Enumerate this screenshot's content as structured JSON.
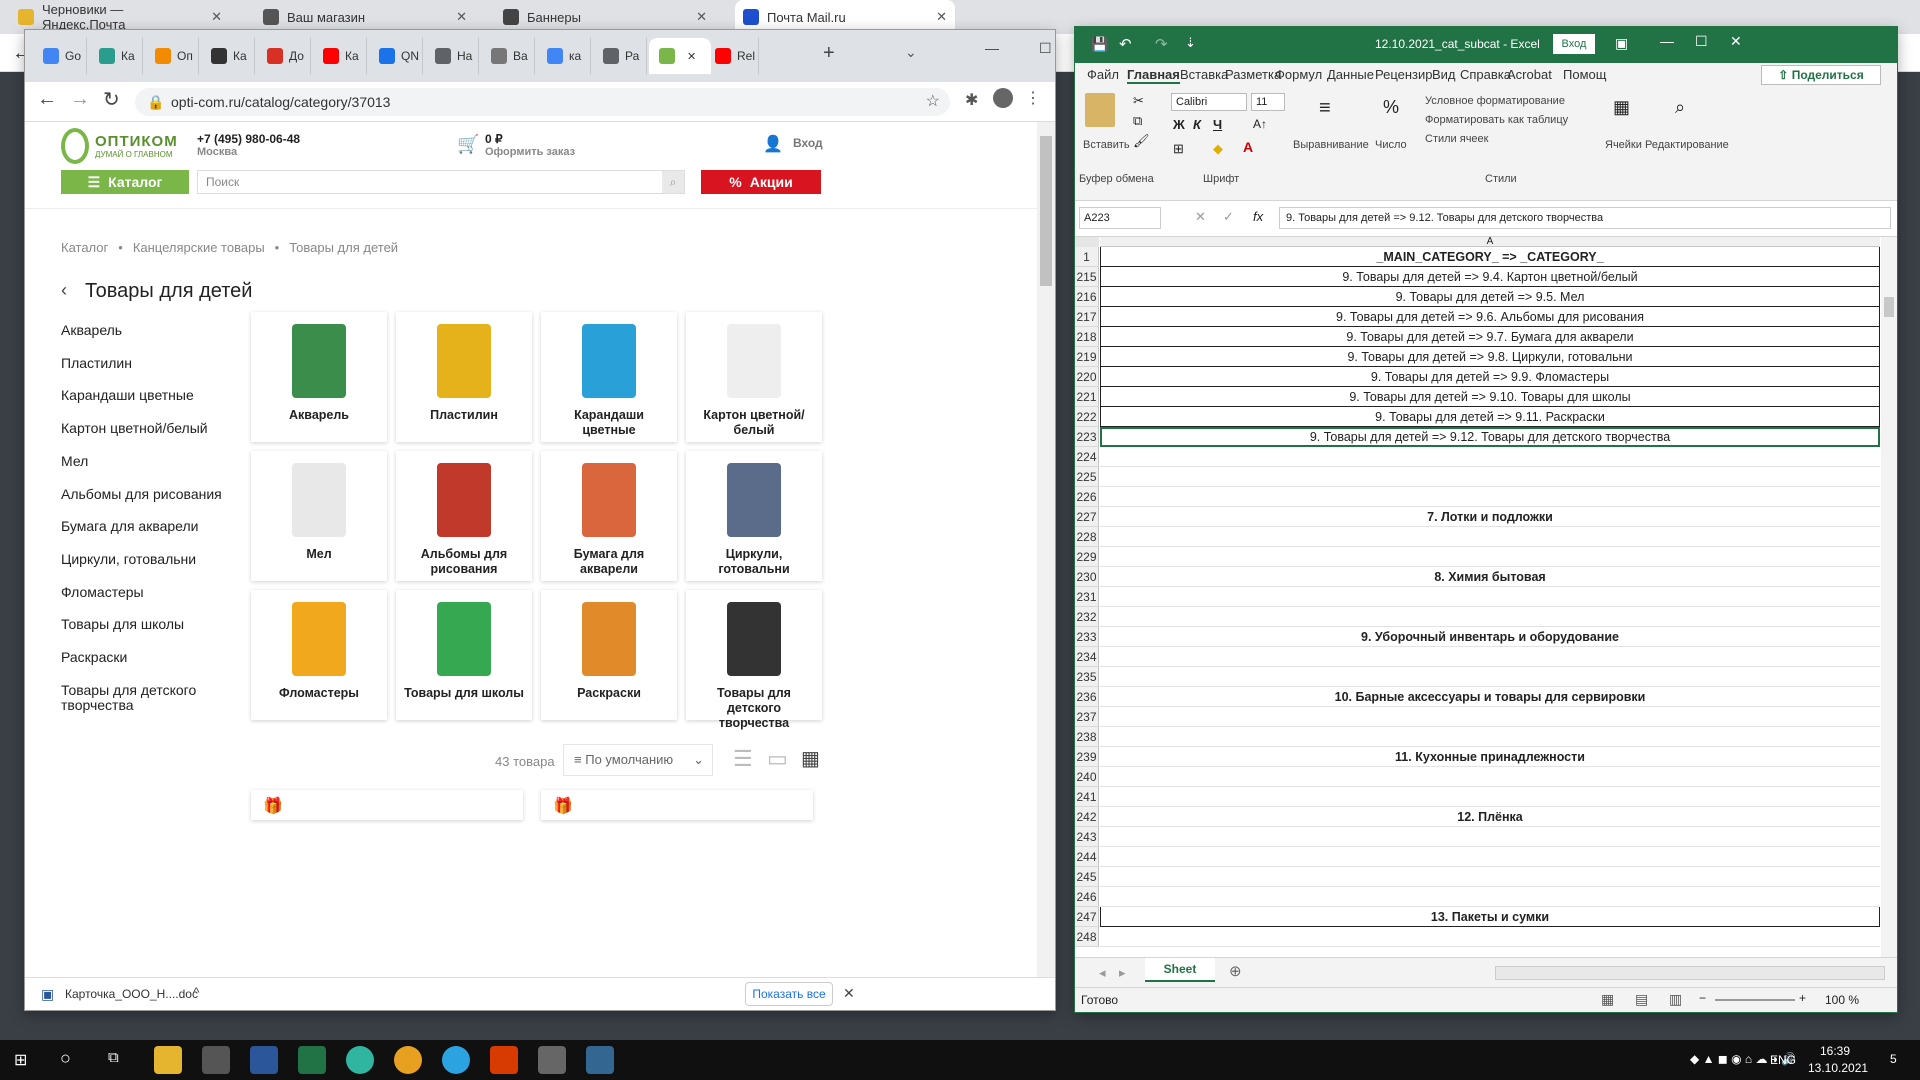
{
  "outer_tabs": [
    {
      "title": "Черновики — Яндекс.Почта",
      "color": "#e6b52f"
    },
    {
      "title": "Ваш магазин",
      "color": "#555555"
    },
    {
      "title": "Баннеры",
      "color": "#444444"
    },
    {
      "title": "Почта Mail.ru",
      "color": "#1d4fcf"
    }
  ],
  "chrome": {
    "tabs": [
      "Go",
      "Ка",
      "Оп",
      "Ка",
      "До",
      "Ка",
      "QN",
      "На",
      "Ва",
      "ка",
      "Ра",
      "",
      "Rel"
    ],
    "tab_colors": [
      "#4285f4",
      "#2a9d8f",
      "#f28b00",
      "#333333",
      "#d93025",
      "#ff0000",
      "#1a73e8",
      "#5f6368",
      "#777777",
      "#4285f4",
      "#5f6368",
      "#7ab648",
      "#ff0000"
    ],
    "url": "opti-com.ru/catalog/category/37013"
  },
  "site": {
    "logo_text": "ОПТИКОМ",
    "logo_tagline": "ДУМАЙ О ГЛАВНОМ",
    "phone": "+7 (495) 980-06-48",
    "city": "Москва",
    "cart_sum": "0 ₽",
    "cart_action": "Оформить заказ",
    "login": "Вход",
    "catalog_btn": "Каталог",
    "search_placeholder": "Поиск",
    "promo_btn": "Акции",
    "breadcrumb": [
      "Каталог",
      "Канцелярские товары",
      "Товары для детей"
    ],
    "page_title": "Товары для детей",
    "sidebar": [
      "Акварель",
      "Пластилин",
      "Карандаши цветные",
      "Картон цветной/белый",
      "Мел",
      "Альбомы для рисования",
      "Бумага для акварели",
      "Циркули, готовальни",
      "Фломастеры",
      "Товары для школы",
      "Раскраски",
      "Товары для детского творчества"
    ],
    "cards": [
      {
        "label": "Акварель",
        "color": "#3a8d4a"
      },
      {
        "label": "Пластилин",
        "color": "#e5b21b"
      },
      {
        "label": "Карандаши цветные",
        "color": "#2aa0d8"
      },
      {
        "label": "Картон цветной/ белый",
        "color": "#eeeeee"
      },
      {
        "label": "Мел",
        "color": "#e8e8e8"
      },
      {
        "label": "Альбомы для рисования",
        "color": "#c0392b"
      },
      {
        "label": "Бумага для акварели",
        "color": "#d9663c"
      },
      {
        "label": "Циркули, готовальни",
        "color": "#5b6c8a"
      },
      {
        "label": "Фломастеры",
        "color": "#f2a81d"
      },
      {
        "label": "Товары для школы",
        "color": "#36a852"
      },
      {
        "label": "Раскраски",
        "color": "#e08a2a"
      },
      {
        "label": "Товары для детского творчества",
        "color": "#333333"
      }
    ],
    "count": "43 товара",
    "sort": "По умолчанию"
  },
  "download": {
    "file": "Карточка_ООО_Н....doc",
    "show_all": "Показать все"
  },
  "excel": {
    "title": "12.10.2021_cat_subcat - Excel",
    "login": "Вход",
    "menu": [
      "Файл",
      "Главная",
      "Вставка",
      "Разметка",
      "Формул",
      "Данные",
      "Рецензир",
      "Вид",
      "Справка",
      "Acrobat",
      "Помощ"
    ],
    "share": "Поделиться",
    "ribbon": {
      "paste": "Вставить",
      "clipboard": "Буфер обмена",
      "font_name": "Calibri",
      "font_size": "11",
      "font_group": "Шрифт",
      "align": "Выравнивание",
      "number": "Число",
      "cond": "Условное форматирование",
      "as_table": "Форматировать как таблицу",
      "cell_styles": "Стили ячеек",
      "styles": "Стили",
      "cells": "Ячейки",
      "editing": "Редактирование"
    },
    "namebox": "A223",
    "formula": "9. Товары для детей => 9.12. Товары для детского творчества",
    "col": "A",
    "rows": [
      {
        "n": "1",
        "v": "_MAIN_CATEGORY_ => _CATEGORY_",
        "bold": true,
        "box": true
      },
      {
        "n": "215",
        "v": "9. Товары для детей => 9.4. Картон цветной/белый",
        "box": true
      },
      {
        "n": "216",
        "v": "9. Товары для детей => 9.5. Мел",
        "box": true
      },
      {
        "n": "217",
        "v": "9. Товары для детей => 9.6. Альбомы для рисования",
        "box": true
      },
      {
        "n": "218",
        "v": "9. Товары для детей => 9.7. Бумага для акварели",
        "box": true
      },
      {
        "n": "219",
        "v": "9. Товары для детей => 9.8. Циркули, готовальни",
        "box": true
      },
      {
        "n": "220",
        "v": "9. Товары для детей => 9.9. Фломастеры",
        "box": true
      },
      {
        "n": "221",
        "v": "9. Товары для детей => 9.10. Товары для школы",
        "box": true
      },
      {
        "n": "222",
        "v": "9. Товары для детей => 9.11. Раскраски",
        "box": true
      },
      {
        "n": "223",
        "v": "9. Товары для детей => 9.12. Товары для детского творчества",
        "box": true,
        "sel": true
      },
      {
        "n": "224",
        "v": ""
      },
      {
        "n": "225",
        "v": ""
      },
      {
        "n": "226",
        "v": ""
      },
      {
        "n": "227",
        "v": "7. Лотки и подложки",
        "bold": true
      },
      {
        "n": "228",
        "v": ""
      },
      {
        "n": "229",
        "v": ""
      },
      {
        "n": "230",
        "v": "8. Химия бытовая",
        "bold": true
      },
      {
        "n": "231",
        "v": ""
      },
      {
        "n": "232",
        "v": ""
      },
      {
        "n": "233",
        "v": "9. Уборочный инвентарь и оборудование",
        "bold": true
      },
      {
        "n": "234",
        "v": ""
      },
      {
        "n": "235",
        "v": ""
      },
      {
        "n": "236",
        "v": "10. Барные аксессуары и товары для сервировки",
        "bold": true
      },
      {
        "n": "237",
        "v": ""
      },
      {
        "n": "238",
        "v": ""
      },
      {
        "n": "239",
        "v": "11. Кухонные принадлежности",
        "bold": true
      },
      {
        "n": "240",
        "v": ""
      },
      {
        "n": "241",
        "v": ""
      },
      {
        "n": "242",
        "v": "12. Плёнка",
        "bold": true
      },
      {
        "n": "243",
        "v": ""
      },
      {
        "n": "244",
        "v": ""
      },
      {
        "n": "245",
        "v": ""
      },
      {
        "n": "246",
        "v": ""
      },
      {
        "n": "247",
        "v": "13. Пакеты и сумки",
        "bold": true,
        "box": true
      },
      {
        "n": "248",
        "v": ""
      }
    ],
    "sheet": "Sheet",
    "status": "Готово",
    "zoom": "100 %"
  },
  "taskbar": {
    "lang": "ENG",
    "time": "16:39",
    "date": "13.10.2021",
    "notif": "5"
  }
}
